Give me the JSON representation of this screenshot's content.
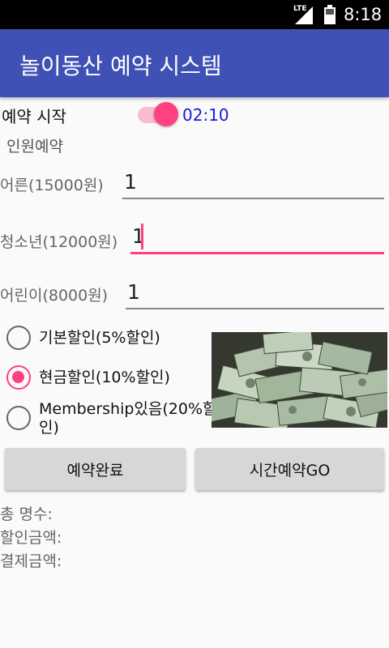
{
  "status_bar": {
    "network": "LTE",
    "time": "8:18",
    "icons": [
      "signal-icon",
      "battery-icon"
    ]
  },
  "app_bar": {
    "title": "놀이동산 예약 시스템",
    "color": "#3f51b5"
  },
  "reservation": {
    "start_label": "예약 시작",
    "switch_on": true,
    "time": "02:10"
  },
  "people_section": {
    "label": "인원예약"
  },
  "fields": {
    "adult": {
      "label": "어른(15000원)",
      "value": "1"
    },
    "youth": {
      "label": "청소년(12000원)",
      "value": "1"
    },
    "child": {
      "label": "어린이(8000원)",
      "value": "1"
    }
  },
  "discounts": {
    "options": [
      {
        "label": "기본할인(5%할인)",
        "checked": false
      },
      {
        "label": "현금할인(10%할인)",
        "checked": true
      },
      {
        "label_line1": "Membership있음(20%할",
        "label_line2": "인)",
        "checked": false
      }
    ]
  },
  "image": {
    "icon": "money-pile-image"
  },
  "buttons": {
    "complete": "예약완료",
    "time_go": "시간예약GO"
  },
  "summary": {
    "total_people": "총 명수:",
    "discount_amount": "할인금액:",
    "payment_amount": "결제금액:"
  },
  "colors": {
    "accent": "#ff4081",
    "time_text": "#1a1ad6"
  }
}
